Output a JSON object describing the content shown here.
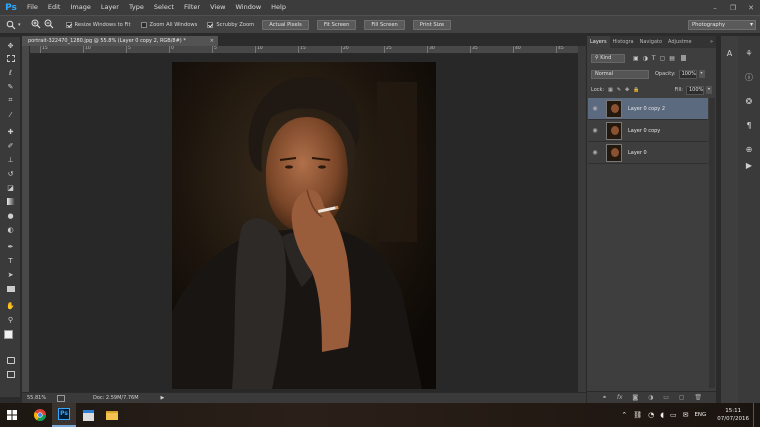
{
  "app": {
    "logo": "Ps",
    "accent": "#31a8ff"
  },
  "menubar": {
    "items": [
      "File",
      "Edit",
      "Image",
      "Layer",
      "Type",
      "Select",
      "Filter",
      "View",
      "Window",
      "Help"
    ]
  },
  "window_controls": {
    "minimize": "–",
    "restore": "❐",
    "close": "✕"
  },
  "options_bar": {
    "zoom_tool_icon": "zoom-icon",
    "checks": [
      {
        "label": "Resize Windows to Fit",
        "checked": true
      },
      {
        "label": "Zoom All Windows",
        "checked": false
      },
      {
        "label": "Scrubby Zoom",
        "checked": true
      }
    ],
    "buttons": [
      "Actual Pixels",
      "Fit Screen",
      "Fill Screen",
      "Print Size"
    ],
    "workspace": "Photography"
  },
  "document": {
    "tab_title": "portrait-322470_1280.jpg @ 55.8% (Layer 0 copy 2, RGB/8#) *",
    "close": "×"
  },
  "ruler_h": [
    "15",
    "10",
    "5",
    "0",
    "5",
    "10",
    "15",
    "20",
    "25",
    "30",
    "35",
    "40",
    "45"
  ],
  "status": {
    "zoom": "55.81%",
    "doc": "Doc: 2.59M/7.76M"
  },
  "panel": {
    "tabs": [
      "Layers",
      "Histogra",
      "Navigato",
      "Adjustme"
    ],
    "kind": "Kind",
    "blend_mode": "Normal",
    "opacity_label": "Opacity:",
    "opacity": "100%",
    "lock_label": "Lock:",
    "fill_label": "Fill:",
    "fill": "100%",
    "layers": [
      {
        "name": "Layer 0 copy 2",
        "selected": true
      },
      {
        "name": "Layer 0 copy",
        "selected": false
      },
      {
        "name": "Layer 0",
        "selected": false
      }
    ],
    "selected_color": "#5c6a80"
  },
  "taskbar": {
    "tray_lang": "ENG",
    "time": "15:11",
    "date": "07/07/2016"
  }
}
